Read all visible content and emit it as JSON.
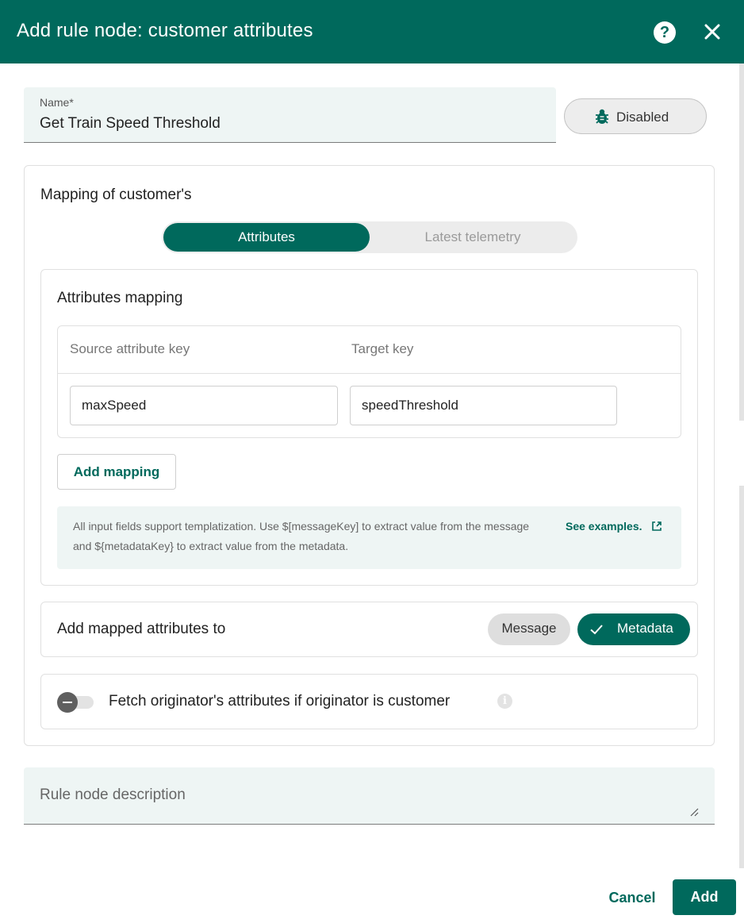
{
  "header": {
    "title": "Add rule node: customer attributes",
    "help_icon": "help-circle-icon",
    "close_icon": "close-icon"
  },
  "name_field": {
    "label": "Name*",
    "value": "Get Train Speed Threshold"
  },
  "debug_button": {
    "icon": "bug-icon",
    "label": "Disabled"
  },
  "mapping": {
    "title": "Mapping of customer's",
    "toggle": {
      "options": [
        "Attributes",
        "Latest telemetry"
      ],
      "selected": "Attributes"
    },
    "attributes_mapping": {
      "title": "Attributes mapping",
      "columns": [
        "Source attribute key",
        "Target key"
      ],
      "rows": [
        {
          "source": "maxSpeed",
          "target": "speedThreshold"
        }
      ],
      "add_button": "Add mapping"
    },
    "hint": {
      "text": "All input fields support templatization. Use $[messageKey] to extract value from the message and ${metadataKey} to extract value from the metadata.",
      "link": "See examples.",
      "link_icon": "open-in-new-icon"
    },
    "destination": {
      "label": "Add mapped attributes to",
      "options": [
        "Message",
        "Metadata"
      ],
      "selected": "Metadata"
    },
    "fetch_originator": {
      "label": "Fetch originator's attributes if originator is customer",
      "enabled": false,
      "info_icon": "info-icon"
    }
  },
  "description": {
    "placeholder": "Rule node description",
    "value": ""
  },
  "actions": {
    "cancel": "Cancel",
    "add": "Add"
  },
  "colors": {
    "primary": "#00695c",
    "field_bg": "#eef5f4"
  }
}
